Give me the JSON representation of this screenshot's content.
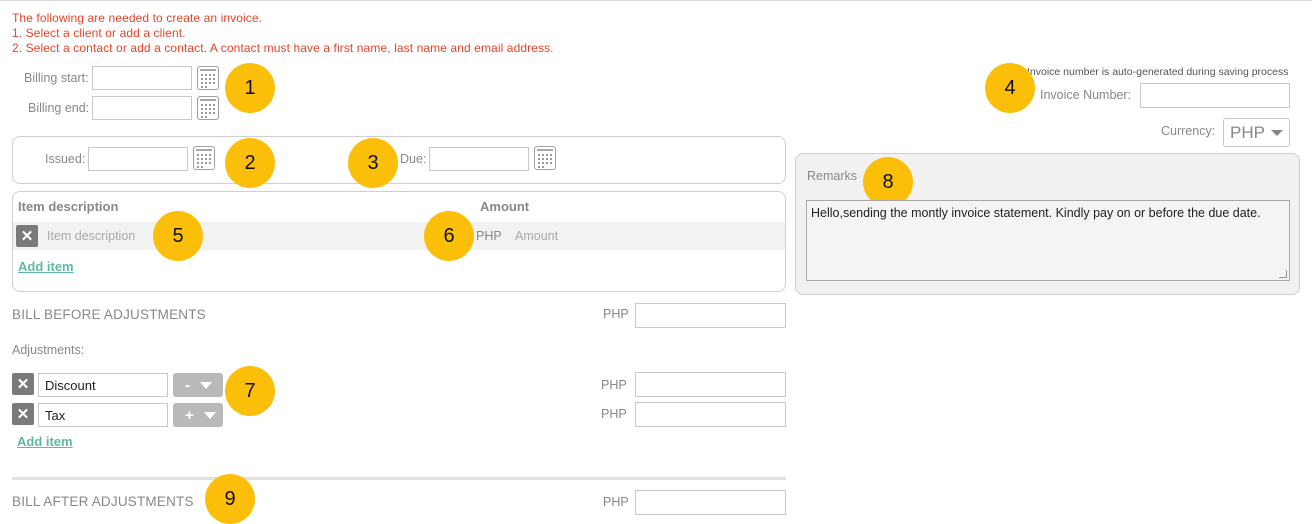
{
  "notice": {
    "line1": "The following are needed to create an invoice.",
    "line2": "1. Select a client or add a client.",
    "line3": "2. Select a contact or add a contact.  A contact must have a first name, last name and email address."
  },
  "billing": {
    "start_label": "Billing start:",
    "end_label": "Billing end:",
    "start_value": "",
    "end_value": ""
  },
  "dates": {
    "issued_label": "Issued:",
    "due_label": "Due:",
    "issued_value": "",
    "due_value": ""
  },
  "invoice": {
    "auto_note": "Invoice number is auto-generated during saving process",
    "number_label": "Invoice Number:",
    "number_value": ""
  },
  "currency": {
    "label": "Currency:",
    "selected": "PHP"
  },
  "remarks": {
    "label": "Remarks",
    "value": "Hello,sending the montly invoice statement. Kindly pay on or before the due date."
  },
  "items": {
    "header_description": "Item description",
    "header_amount": "Amount",
    "rows": [
      {
        "description_placeholder": "Item description",
        "currency": "PHP",
        "amount_placeholder": "Amount"
      }
    ],
    "add_item": "Add item"
  },
  "bill_before": {
    "label": "BILL BEFORE ADJUSTMENTS",
    "currency": "PHP",
    "value": ""
  },
  "adjustments": {
    "label": "Adjustments:",
    "rows": [
      {
        "name": "Discount",
        "operator": "-",
        "currency": "PHP",
        "value": ""
      },
      {
        "name": "Tax",
        "operator": "+",
        "currency": "PHP",
        "value": ""
      }
    ],
    "add_item": "Add item"
  },
  "bill_after": {
    "label": "BILL AFTER ADJUSTMENTS",
    "currency": "PHP",
    "value": ""
  },
  "callouts": [
    "1",
    "2",
    "3",
    "4",
    "5",
    "6",
    "7",
    "8",
    "9"
  ],
  "colors": {
    "notice_red": "#e8452a",
    "callout_yellow": "#fbbf0a",
    "link_teal": "#5fb8a6"
  }
}
